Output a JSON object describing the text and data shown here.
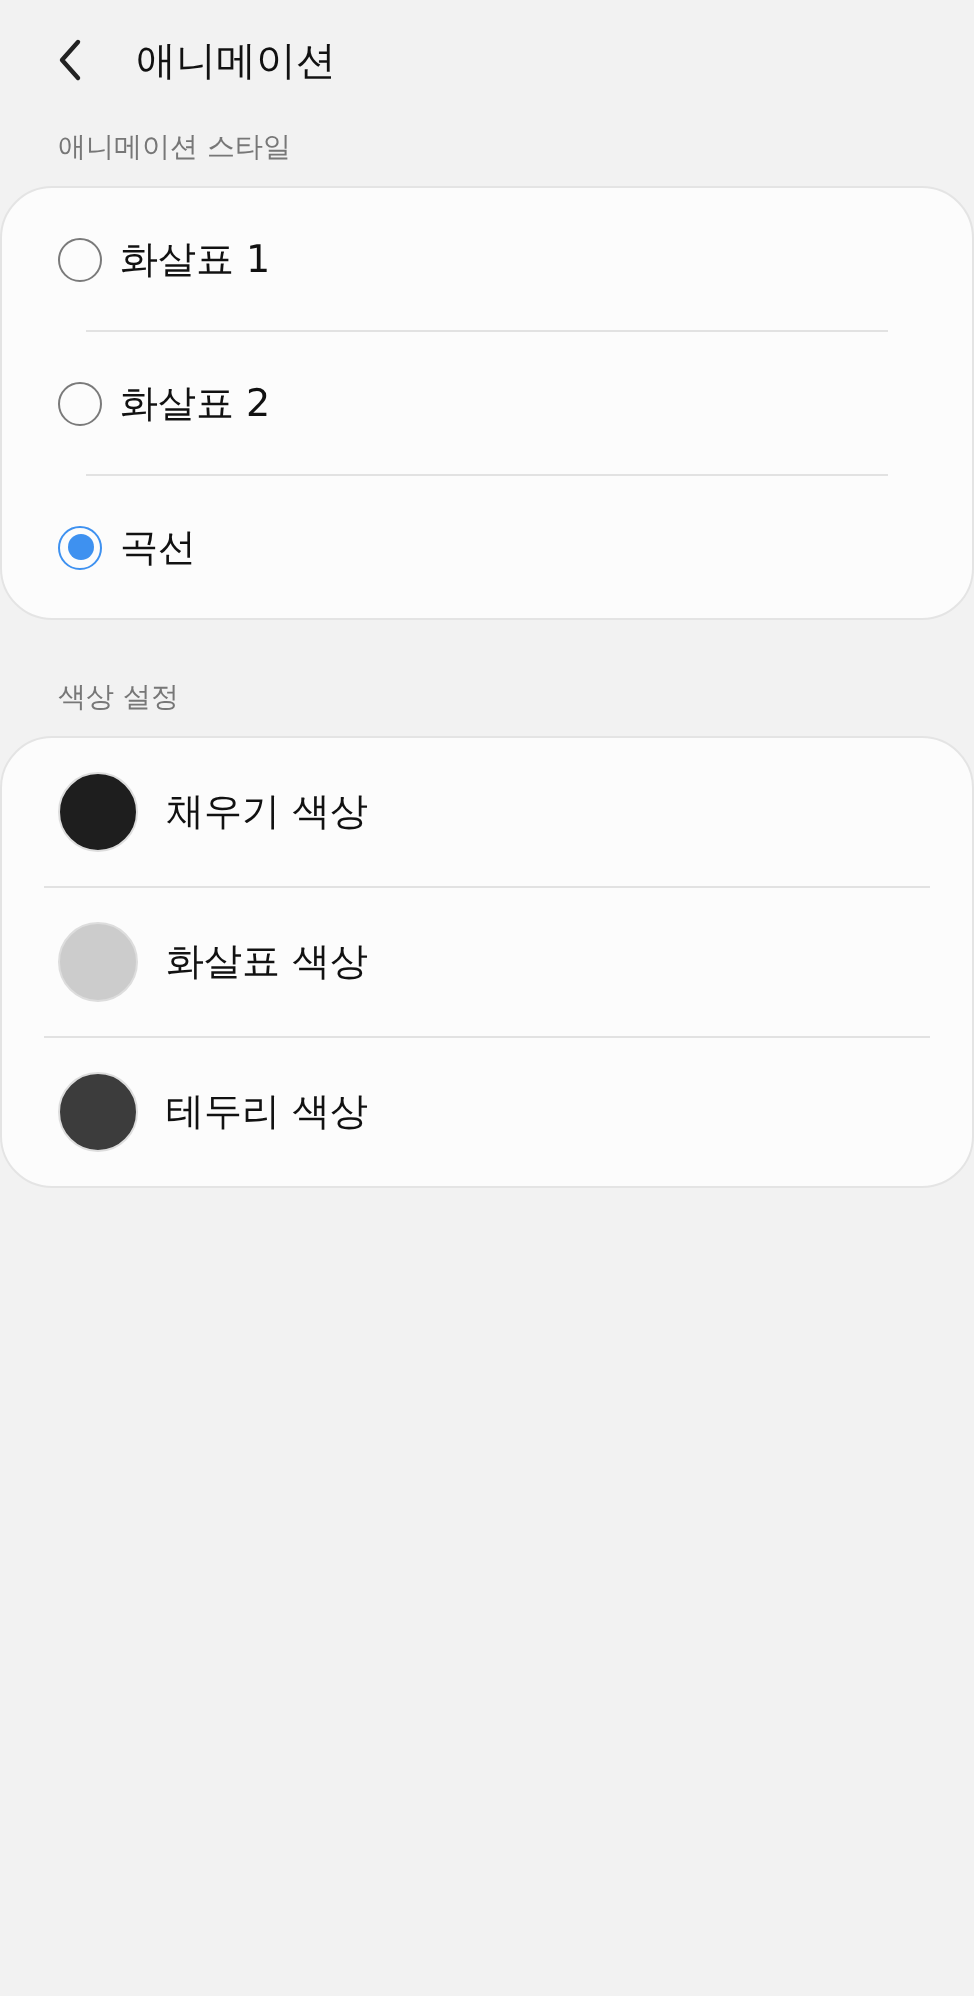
{
  "header": {
    "title": "애니메이션"
  },
  "animation_style": {
    "label": "애니메이션 스타일",
    "options": [
      {
        "label": "화살표 1",
        "selected": false
      },
      {
        "label": "화살표 2",
        "selected": false
      },
      {
        "label": "곡선",
        "selected": true
      }
    ]
  },
  "color_settings": {
    "label": "색상 설정",
    "items": [
      {
        "label": "채우기 색상",
        "color": "#1e1e1e"
      },
      {
        "label": "화살표 색상",
        "color": "#cccccc"
      },
      {
        "label": "테두리 색상",
        "color": "#3c3c3c"
      }
    ]
  }
}
